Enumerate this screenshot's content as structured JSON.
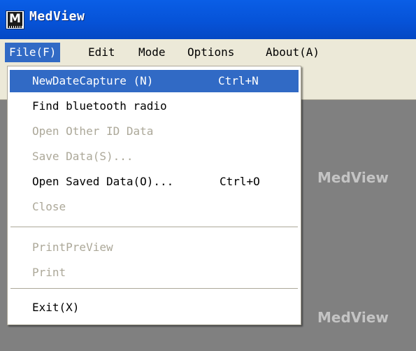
{
  "window": {
    "title": "MedView",
    "icon": "medview-app-icon",
    "icon_letter": "M"
  },
  "menubar": {
    "items": [
      {
        "label": "File(F)",
        "hotkey": "F",
        "active": true
      },
      {
        "label": "Edit"
      },
      {
        "label": "Mode"
      },
      {
        "label": "Options"
      },
      {
        "label": "About(A)",
        "hotkey": "A"
      }
    ]
  },
  "workspace": {
    "labels": [
      "MedView",
      "MedView"
    ]
  },
  "file_menu": {
    "items": [
      {
        "label": "NewDateCapture (N)",
        "shortcut": "Ctrl+N",
        "enabled": true,
        "highlighted": true
      },
      {
        "label": "Find bluetooth radio",
        "enabled": true
      },
      {
        "label": "Open Other ID Data",
        "enabled": false
      },
      {
        "label": "Save Data(S)...",
        "enabled": false
      },
      {
        "label": "Open Saved Data(O)...",
        "shortcut": "Ctrl+O",
        "enabled": true
      },
      {
        "label": "Close",
        "enabled": false
      },
      {
        "label": "PrintPreView",
        "enabled": false
      },
      {
        "label": "Print",
        "enabled": false
      },
      {
        "label": "Exit(X)",
        "enabled": true
      }
    ]
  },
  "colors": {
    "titlebar": "#0653d8",
    "menubar": "#ece9d8",
    "highlight": "#316ac5",
    "disabled_text": "#aca899",
    "workspace": "#808080"
  }
}
